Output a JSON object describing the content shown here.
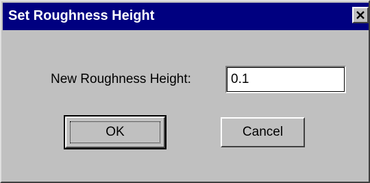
{
  "dialog": {
    "title": "Set Roughness Height",
    "close_icon": "close-icon"
  },
  "form": {
    "label": "New Roughness Height:",
    "value": "0.1"
  },
  "buttons": {
    "ok": "OK",
    "cancel": "Cancel"
  },
  "colors": {
    "titlebar": "#000080",
    "face": "#c0c0c0"
  }
}
